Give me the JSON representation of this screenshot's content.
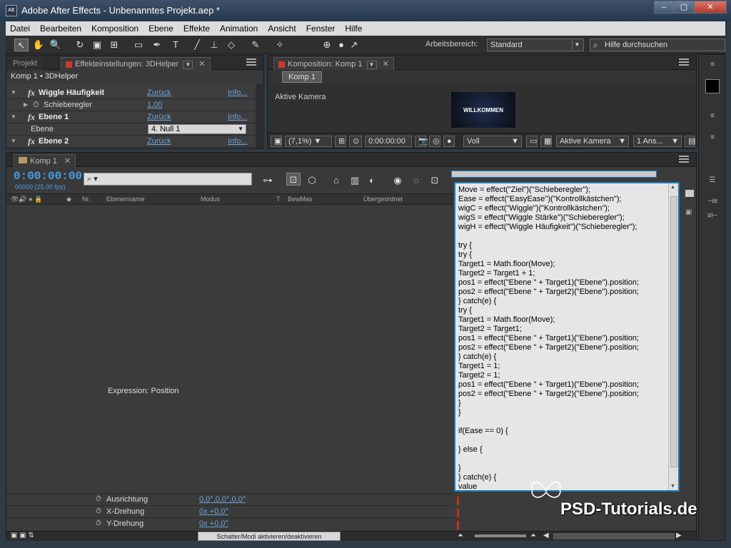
{
  "window": {
    "app_icon": "AE",
    "title": "Adobe After Effects - Unbenanntes Projekt.aep *",
    "controls": [
      "–",
      "▢",
      "✕"
    ]
  },
  "menu": [
    "Datei",
    "Bearbeiten",
    "Komposition",
    "Ebene",
    "Effekte",
    "Animation",
    "Ansicht",
    "Fenster",
    "Hilfe"
  ],
  "toolbar": {
    "workspace_label": "Arbeitsbereich:",
    "workspace_value": "Standard",
    "help_placeholder": "Hilfe durchsuchen"
  },
  "project_panel": {
    "tab_project": "Projekt",
    "tab_effects": "Effekteinstellungen: 3DHelper",
    "breadcrumb": "Komp 1 • 3DHelper",
    "rows": [
      {
        "name": "Wiggle Häufigkeit",
        "reset": "Zurück",
        "info": "Info..."
      },
      {
        "sub": "Schieberegler",
        "value": "1,00"
      },
      {
        "name": "Ebene 1",
        "reset": "Zurück",
        "info": "Info..."
      },
      {
        "sub": "Ebene",
        "select": "4. Null 1"
      },
      {
        "name": "Ebene 2",
        "reset": "Zurück",
        "info": "Info..."
      }
    ]
  },
  "comp_panel": {
    "tab": "Komposition: Komp 1",
    "komp_button": "Komp 1",
    "camera_label": "Aktive Kamera",
    "preview_text": "WILLKOMMEN",
    "zoom": "(7,1%)",
    "timecode": "0:00:00:00",
    "resolution": "Voll",
    "camera_select": "Aktive Kamera",
    "views_select": "1 Ans..."
  },
  "timeline": {
    "tab": "Komp 1",
    "timecode": "0:00:00:00",
    "fps": "00000 (25.00 fps)",
    "columns": {
      "nr": "Nr.",
      "name": "Ebenenname",
      "mode": "Modus",
      "t": "T",
      "trkmat": "BewMas",
      "parent": "Übergeordnet"
    },
    "expr_label": "Expression: Position",
    "props": [
      {
        "label": "Ausrichtung",
        "value": "0,0°,0,0°,0,0°"
      },
      {
        "label": "X-Drehung",
        "value": "0x +0,0°"
      },
      {
        "label": "Y-Drehung",
        "value": "0x +0,0°"
      }
    ],
    "toggle_label": "Schalter/Modi aktivieren/deaktivieren"
  },
  "expression_code": "Move = effect(\"Ziel\")(\"Schieberegler\");\nEase = effect(\"EasyEase\")(\"Kontrollkästchen\");\nwigC = effect(\"Wiggle\")(\"Kontrollkästchen\");\nwigS = effect(\"Wiggle Stärke\")(\"Schieberegler\");\nwigH = effect(\"Wiggle Häufigkeit\")(\"Schieberegler\");\n\ntry {\ntry {\nTarget1 = Math.floor(Move);\nTarget2 = Target1 + 1;\npos1 = effect(\"Ebene \" + Target1)(\"Ebene\").position;\npos2 = effect(\"Ebene \" + Target2)(\"Ebene\").position;\n} catch(e) {\ntry {\nTarget1 = Math.floor(Move);\nTarget2 = Target1;\npos1 = effect(\"Ebene \" + Target1)(\"Ebene\").position;\npos2 = effect(\"Ebene \" + Target2)(\"Ebene\").position;\n} catch(e) {\nTarget1 = 1;\nTarget2 = 1;\npos1 = effect(\"Ebene \" + Target1)(\"Ebene\").position;\npos2 = effect(\"Ebene \" + Target2)(\"Ebene\").position;\n}\n}\n\nif(Ease == 0) {\n\n} else {\n\n}\n} catch(e) {\nvalue",
  "watermark": "PSD-Tutorials.de"
}
